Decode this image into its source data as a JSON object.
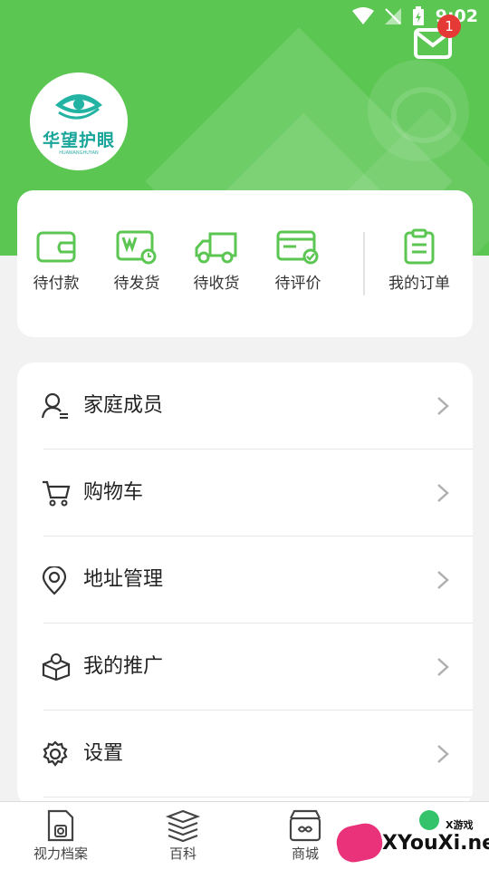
{
  "status_bar": {
    "time": "9:02",
    "icons": [
      "wifi-icon",
      "no-signal-icon",
      "battery-charging-icon"
    ]
  },
  "header": {
    "mail_badge": "1",
    "logo_text": "华望护眼",
    "logo_subtext": "HUAWANGHUYAN",
    "accent_color": "#5cc653"
  },
  "orders": {
    "items": [
      {
        "label": "待付款",
        "icon": "wallet-icon"
      },
      {
        "label": "待发货",
        "icon": "pending-shipment-icon"
      },
      {
        "label": "待收货",
        "icon": "truck-icon"
      },
      {
        "label": "待评价",
        "icon": "review-icon"
      }
    ],
    "all_orders_label": "我的订单"
  },
  "menu": {
    "items": [
      {
        "label": "家庭成员",
        "icon": "family-member-icon"
      },
      {
        "label": "购物车",
        "icon": "cart-icon"
      },
      {
        "label": "地址管理",
        "icon": "location-icon"
      },
      {
        "label": "我的推广",
        "icon": "promotion-box-icon"
      },
      {
        "label": "设置",
        "icon": "gear-icon"
      }
    ]
  },
  "tabbar": {
    "items": [
      {
        "label": "视力档案",
        "icon": "vision-record-icon"
      },
      {
        "label": "百科",
        "icon": "encyclopedia-icon"
      },
      {
        "label": "商城",
        "icon": "store-icon"
      }
    ]
  },
  "watermark": {
    "mini": "X游戏",
    "text": "XYouXi.net"
  }
}
